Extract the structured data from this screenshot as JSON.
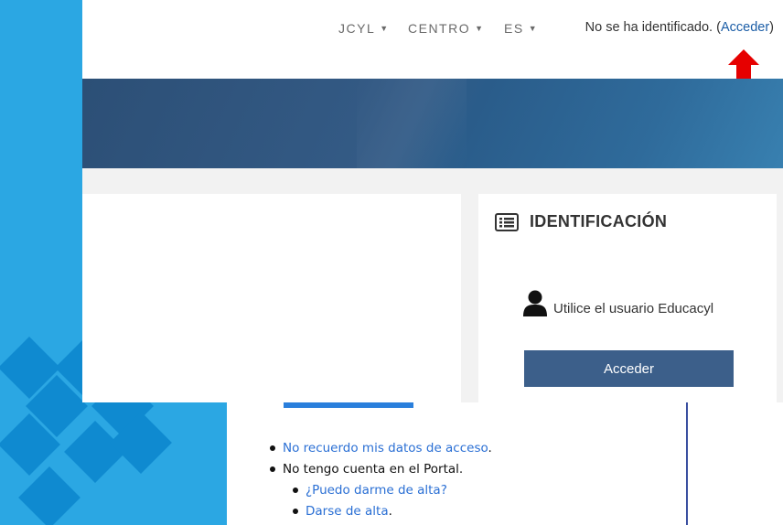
{
  "topbar": {
    "menu_jcyl": "JCYL",
    "menu_centro": "CENTRO",
    "menu_lang": "ES",
    "login_prefix": "No se ha identificado. (",
    "login_link": "Acceder",
    "login_suffix": ")"
  },
  "login_block": {
    "title": "IDENTIFICACIÓN",
    "user_hint": "Utilice el usuario Educacyl",
    "button_label": "Acceder"
  },
  "lower_page": {
    "links": [
      {
        "label": "No recuerdo mis datos de acceso",
        "suffix": "."
      },
      {
        "label": "No tengo cuenta en el Portal.",
        "suffix": ""
      },
      {
        "label": "¿Puedo darme de alta?",
        "suffix": ""
      },
      {
        "label": "Darse de alta",
        "suffix": "."
      }
    ]
  },
  "colors": {
    "deco_blue": "#2ba7e3",
    "banner": "#2c4f76",
    "button": "#3c5f8a",
    "link": "#2a6fd4",
    "annotation_arrow": "#e60000"
  },
  "icons": {
    "arrow": "red-arrow-up-icon",
    "block": "list-card-icon",
    "user": "user-silhouette-icon"
  }
}
